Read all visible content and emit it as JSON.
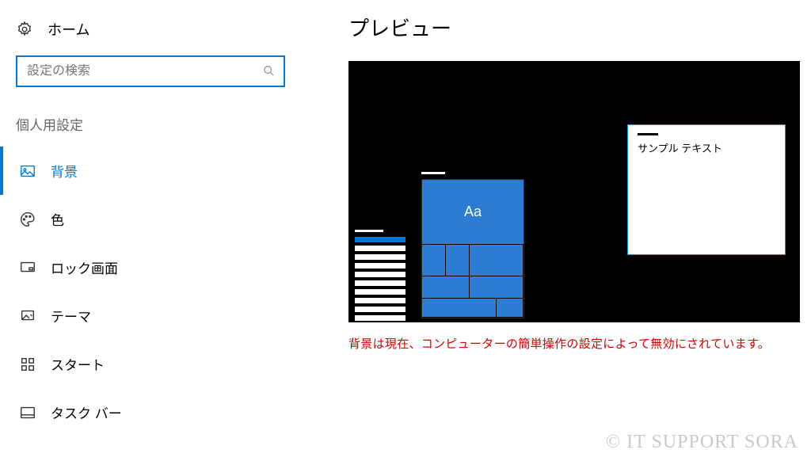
{
  "sidebar": {
    "home_label": "ホーム",
    "search_placeholder": "設定の検索",
    "section_header": "個人用設定",
    "items": [
      {
        "label": "背景",
        "icon": "image-icon",
        "active": true
      },
      {
        "label": "色",
        "icon": "palette-icon",
        "active": false
      },
      {
        "label": "ロック画面",
        "icon": "monitor-icon",
        "active": false
      },
      {
        "label": "テーマ",
        "icon": "paint-icon",
        "active": false
      },
      {
        "label": "スタート",
        "icon": "grid-icon",
        "active": false
      },
      {
        "label": "タスク バー",
        "icon": "taskbar-icon",
        "active": false
      }
    ]
  },
  "main": {
    "title": "プレビュー",
    "preview": {
      "tile_label": "Aa",
      "sample_text": "サンプル テキスト"
    },
    "warning": "背景は現在、コンピューターの簡単操作の設定によって無効にされています。"
  },
  "watermark": "© IT SUPPORT SORA",
  "colors": {
    "accent": "#0078d7",
    "warning": "#d20000"
  }
}
